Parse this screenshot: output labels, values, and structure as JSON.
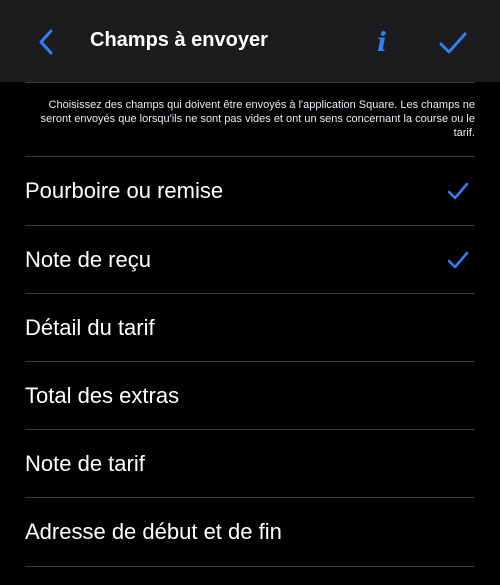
{
  "header": {
    "title": "Champs à envoyer",
    "back_icon": "chevron-left-icon",
    "info_label": "i",
    "done_icon": "checkmark-icon"
  },
  "description": "Choisissez des champs qui doivent être envoyés à l'application Square. Les champs ne seront envoyés que lorsqu'ils ne sont pas vides et ont un sens concernant la course ou le tarif.",
  "fields": [
    {
      "label": "Pourboire ou remise",
      "selected": true
    },
    {
      "label": "Note de reçu",
      "selected": true
    },
    {
      "label": "Détail du tarif",
      "selected": false
    },
    {
      "label": "Total des extras",
      "selected": false
    },
    {
      "label": "Note de tarif",
      "selected": false
    },
    {
      "label": "Adresse de début et de fin",
      "selected": false
    }
  ],
  "colors": {
    "accent": "#2f7ff5",
    "background": "#000000",
    "nav_background": "#1c1c1e",
    "separator": "#3a3a3c"
  }
}
